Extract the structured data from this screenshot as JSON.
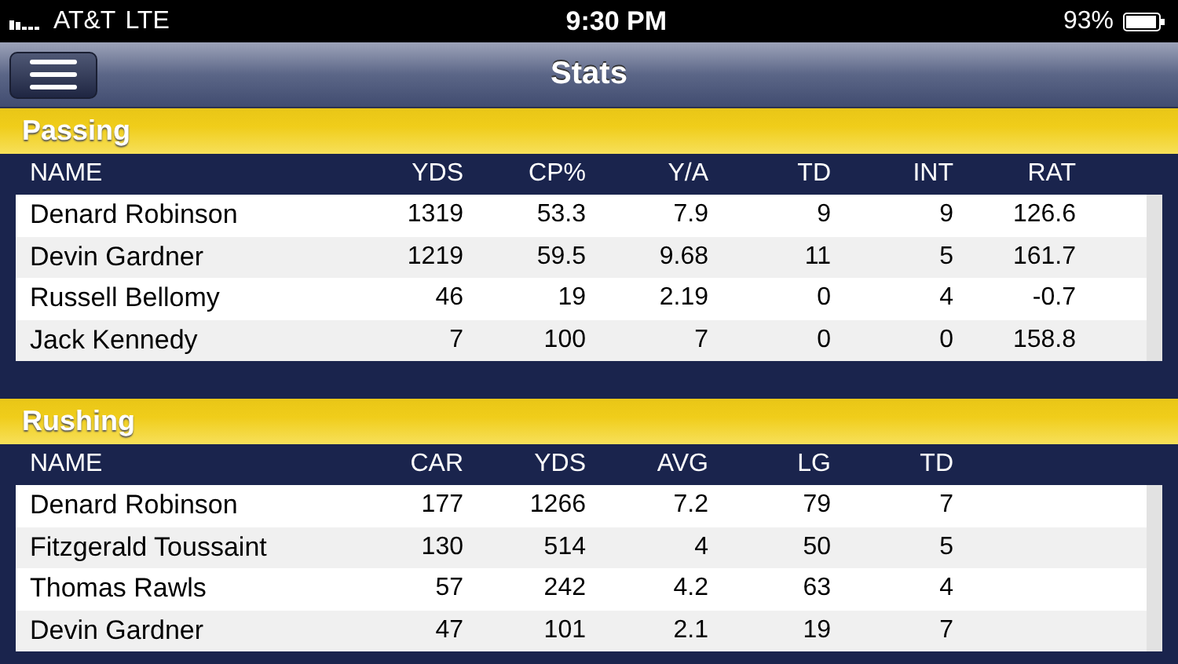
{
  "status_bar": {
    "carrier": "AT&T",
    "network": "LTE",
    "time": "9:30 PM",
    "battery": "93%"
  },
  "nav_bar": {
    "title": "Stats"
  },
  "sections": [
    {
      "title": "Passing",
      "columns": [
        "NAME",
        "YDS",
        "CP%",
        "Y/A",
        "TD",
        "INT",
        "RAT"
      ],
      "rows": [
        [
          "Denard Robinson",
          "1319",
          "53.3",
          "7.9",
          "9",
          "9",
          "126.6"
        ],
        [
          "Devin Gardner",
          "1219",
          "59.5",
          "9.68",
          "11",
          "5",
          "161.7"
        ],
        [
          "Russell Bellomy",
          "46",
          "19",
          "2.19",
          "0",
          "4",
          "-0.7"
        ],
        [
          "Jack Kennedy",
          "7",
          "100",
          "7",
          "0",
          "0",
          "158.8"
        ]
      ]
    },
    {
      "title": "Rushing",
      "columns": [
        "NAME",
        "CAR",
        "YDS",
        "AVG",
        "LG",
        "TD"
      ],
      "rows": [
        [
          "Denard Robinson",
          "177",
          "1266",
          "7.2",
          "79",
          "7"
        ],
        [
          "Fitzgerald Toussaint",
          "130",
          "514",
          "4",
          "50",
          "5"
        ],
        [
          "Thomas Rawls",
          "57",
          "242",
          "4.2",
          "63",
          "4"
        ],
        [
          "Devin Gardner",
          "47",
          "101",
          "2.1",
          "19",
          "7"
        ]
      ]
    }
  ]
}
